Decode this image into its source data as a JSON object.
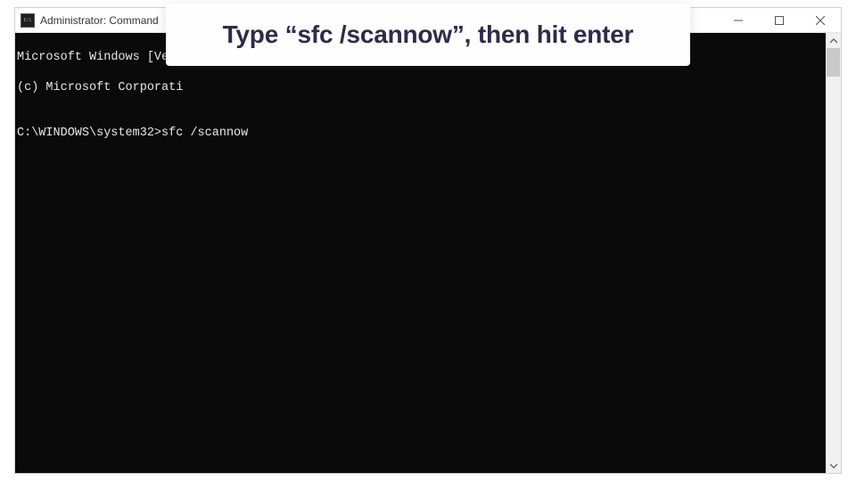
{
  "window": {
    "title": "Administrator: Command"
  },
  "console": {
    "line1": "Microsoft Windows [Vers",
    "line2": "(c) Microsoft Corporati",
    "blank": "",
    "prompt": "C:\\WINDOWS\\system32>",
    "command": "sfc /scannow"
  },
  "callout": {
    "text": "Type “sfc /scannow”, then hit enter"
  }
}
